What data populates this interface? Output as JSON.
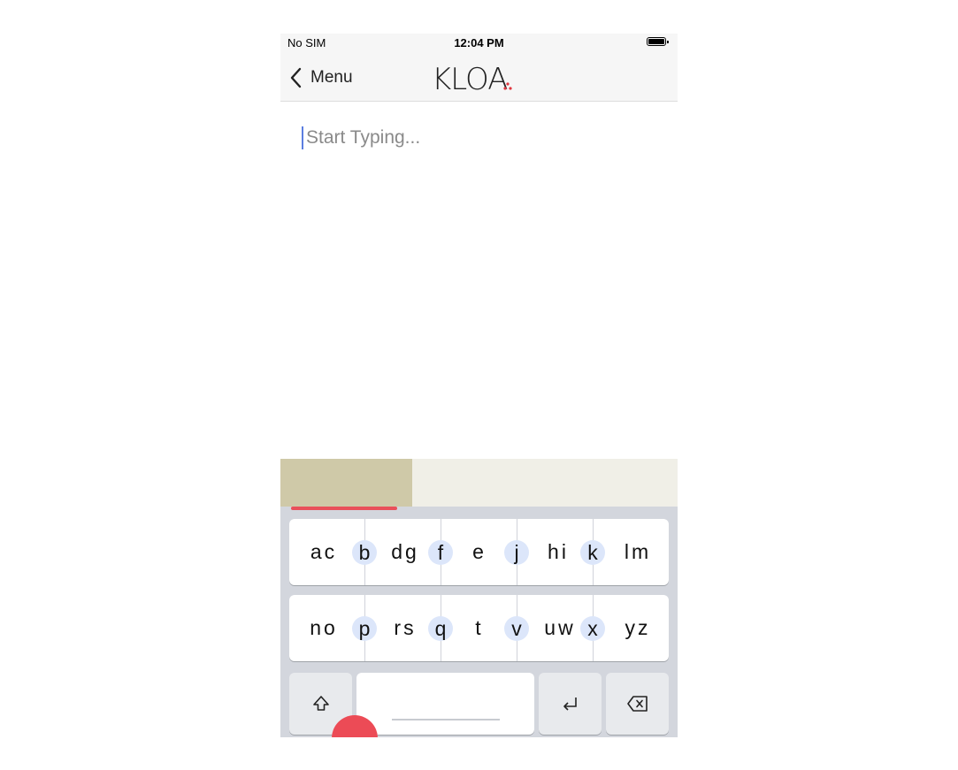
{
  "status": {
    "carrier": "No SIM",
    "time": "12:04 PM"
  },
  "nav": {
    "back_label": "Menu",
    "logo_text": "KLOA"
  },
  "editor": {
    "placeholder": "Start Typing..."
  },
  "keyboard": {
    "row1": [
      {
        "text": "ac",
        "name": "key-group-ac"
      },
      {
        "text": "dg",
        "name": "key-group-dg"
      },
      {
        "text": "e",
        "name": "key-group-e"
      },
      {
        "text": "hi",
        "name": "key-group-hi"
      },
      {
        "text": "lm",
        "name": "key-group-lm"
      }
    ],
    "row1_pills": [
      "b",
      "f",
      "j",
      "k"
    ],
    "row2": [
      {
        "text": "no",
        "name": "key-group-no"
      },
      {
        "text": "rs",
        "name": "key-group-rs"
      },
      {
        "text": "t",
        "name": "key-group-t"
      },
      {
        "text": "uw",
        "name": "key-group-uw"
      },
      {
        "text": "yz",
        "name": "key-group-yz"
      }
    ],
    "row2_pills": [
      "p",
      "q",
      "v",
      "x"
    ],
    "icons": {
      "shift": "shift-icon",
      "return": "return-icon",
      "delete": "delete-icon"
    }
  },
  "colors": {
    "accent_red": "#ec4b56",
    "suggestion_active": "#cfc9a8",
    "suggestion_bg": "#f0efe7",
    "pill_bg": "#dce6fa",
    "caret": "#5b7ee0"
  }
}
